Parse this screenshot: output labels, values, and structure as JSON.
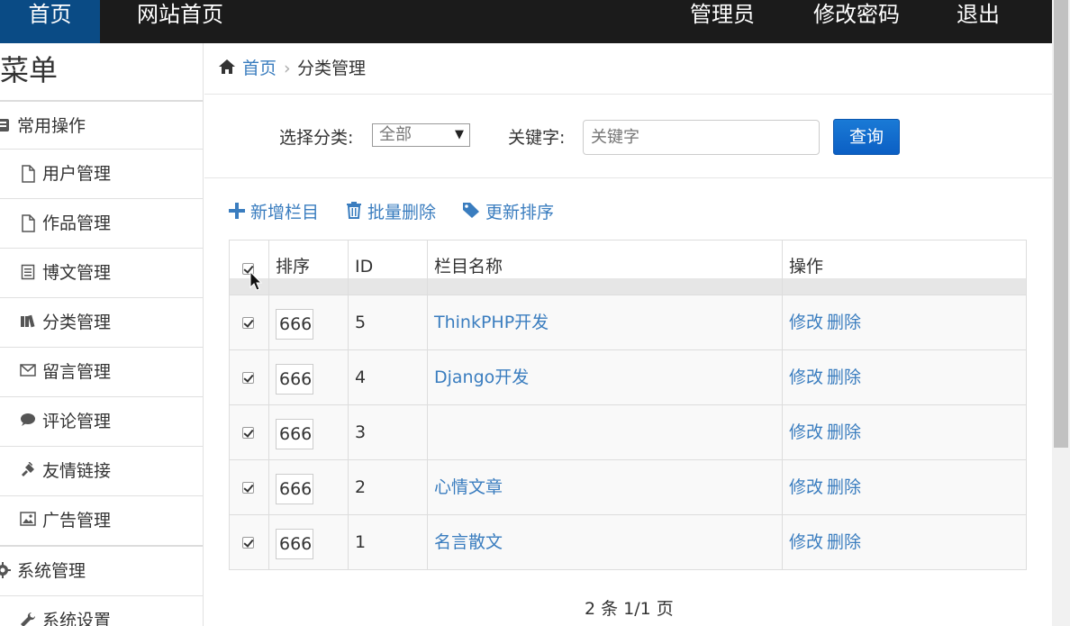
{
  "topbar": {
    "home": "首页",
    "site_home": "网站首页",
    "admin": "管理员",
    "change_password": "修改密码",
    "logout": "退出",
    "colors": {
      "bar": "#1b1b1b",
      "active": "#0a4b85"
    }
  },
  "sidebar": {
    "title": "菜单",
    "groups": [
      {
        "label": "常用操作",
        "icon": "grid-icon"
      },
      {
        "label": "系统管理",
        "icon": "gear-icon"
      }
    ],
    "items": [
      {
        "label": "用户管理",
        "icon": "file-icon"
      },
      {
        "label": "作品管理",
        "icon": "file-icon"
      },
      {
        "label": "博文管理",
        "icon": "list-icon"
      },
      {
        "label": "分类管理",
        "icon": "books-icon"
      },
      {
        "label": "留言管理",
        "icon": "envelope-icon"
      },
      {
        "label": "评论管理",
        "icon": "comment-icon"
      },
      {
        "label": "友情链接",
        "icon": "plug-icon"
      },
      {
        "label": "广告管理",
        "icon": "picture-icon"
      },
      {
        "label": "系统设置",
        "icon": "wrench-icon"
      }
    ]
  },
  "breadcrumb": {
    "home": "首页",
    "separator": "›",
    "current": "分类管理"
  },
  "search": {
    "category_label": "选择分类:",
    "category_value": "全部",
    "keyword_label": "关键字:",
    "keyword_placeholder": "关键字",
    "query_button": "查询"
  },
  "actions": {
    "add": "新增栏目",
    "batch_delete": "批量删除",
    "update_sort": "更新排序",
    "link_color": "#3a7dbf"
  },
  "table": {
    "headers": [
      "排序",
      "ID",
      "栏目名称",
      "操作"
    ],
    "rows": [
      {
        "sort": "666",
        "id": "5",
        "name": "ThinkPHP开发",
        "edit": "修改",
        "delete": "删除"
      },
      {
        "sort": "666",
        "id": "4",
        "name": "Django开发",
        "edit": "修改",
        "delete": "删除"
      },
      {
        "sort": "666",
        "id": "3",
        "name": "",
        "edit": "修改",
        "delete": "删除"
      },
      {
        "sort": "666",
        "id": "2",
        "name": "心情文章",
        "edit": "修改",
        "delete": "删除"
      },
      {
        "sort": "666",
        "id": "1",
        "name": "名言散文",
        "edit": "修改",
        "delete": "删除"
      }
    ]
  },
  "pager": {
    "text": "2 条 1/1 页"
  }
}
